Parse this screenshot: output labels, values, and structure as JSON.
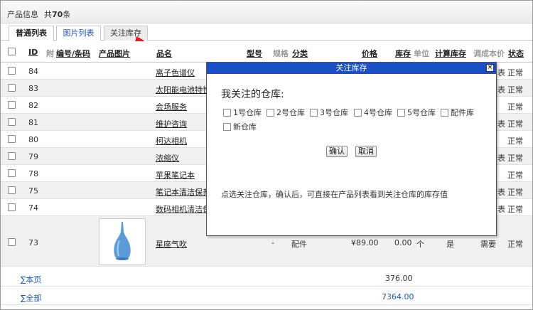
{
  "header": {
    "title": "产品信息",
    "count_prefix": "共",
    "count_value": "70",
    "count_suffix": "条"
  },
  "tabs": [
    {
      "label": "普通列表",
      "state": "active"
    },
    {
      "label": "图片列表",
      "state": "link"
    },
    {
      "label": "关注库存",
      "state": "highlighted"
    }
  ],
  "columns": {
    "id": "ID",
    "attach": "附",
    "code": "编号/条码",
    "image": "产品图片",
    "name": "品名",
    "model": "型号",
    "spec": "规格",
    "category": "分类",
    "price": "价格",
    "stock": "库存",
    "unit": "单位",
    "calc_stock": "计算库存",
    "adjust_cost": "调成本价",
    "status": "状态"
  },
  "rows": [
    {
      "id": "84",
      "name": "离子色谱仪",
      "status": "正常"
    },
    {
      "id": "83",
      "name": "太阳能电池特性",
      "status": "正常"
    },
    {
      "id": "82",
      "name": "会场服务",
      "status": "正常"
    },
    {
      "id": "81",
      "name": "维护咨询",
      "status": "正常"
    },
    {
      "id": "80",
      "name": "柯达相机",
      "status": "正常"
    },
    {
      "id": "79",
      "name": "浓缩仪",
      "status": "正常"
    },
    {
      "id": "78",
      "name": "苹果笔记本",
      "status": "正常"
    },
    {
      "id": "75",
      "name": "笔记本清洁保养",
      "status": "正常"
    },
    {
      "id": "74",
      "name": "数码相机清洁保",
      "status": "正常"
    },
    {
      "id": "73",
      "name": "星座气吹",
      "model": "-",
      "category": "配件",
      "price": "¥89.00",
      "stock": "0.00",
      "unit": "个",
      "calc_stock": "是",
      "adjust_cost": "需要",
      "status": "正常"
    }
  ],
  "row_partial_text": {
    "r84": "表",
    "r83": "表",
    "r81": "表",
    "r79": "表",
    "r75": "表",
    "r74": "表"
  },
  "summary": [
    {
      "label": "∑本页",
      "value": "376.00"
    },
    {
      "label": "∑全部",
      "value": "7364.00"
    }
  ],
  "modal": {
    "title": "关注库存",
    "close": "×",
    "heading": "我关注的仓库:",
    "warehouses": [
      "1号仓库",
      "2号仓库",
      "3号仓库",
      "4号仓库",
      "5号仓库",
      "配件库",
      "新仓库"
    ],
    "confirm": "确认",
    "cancel": "取消",
    "hint": "点选关注仓库，确认后，可直接在产品列表看到关注仓库的库存值"
  },
  "colors": {
    "modal_title_bg": "#1a4fc6",
    "link": "#1d58b8",
    "arrow": "#e02020"
  }
}
